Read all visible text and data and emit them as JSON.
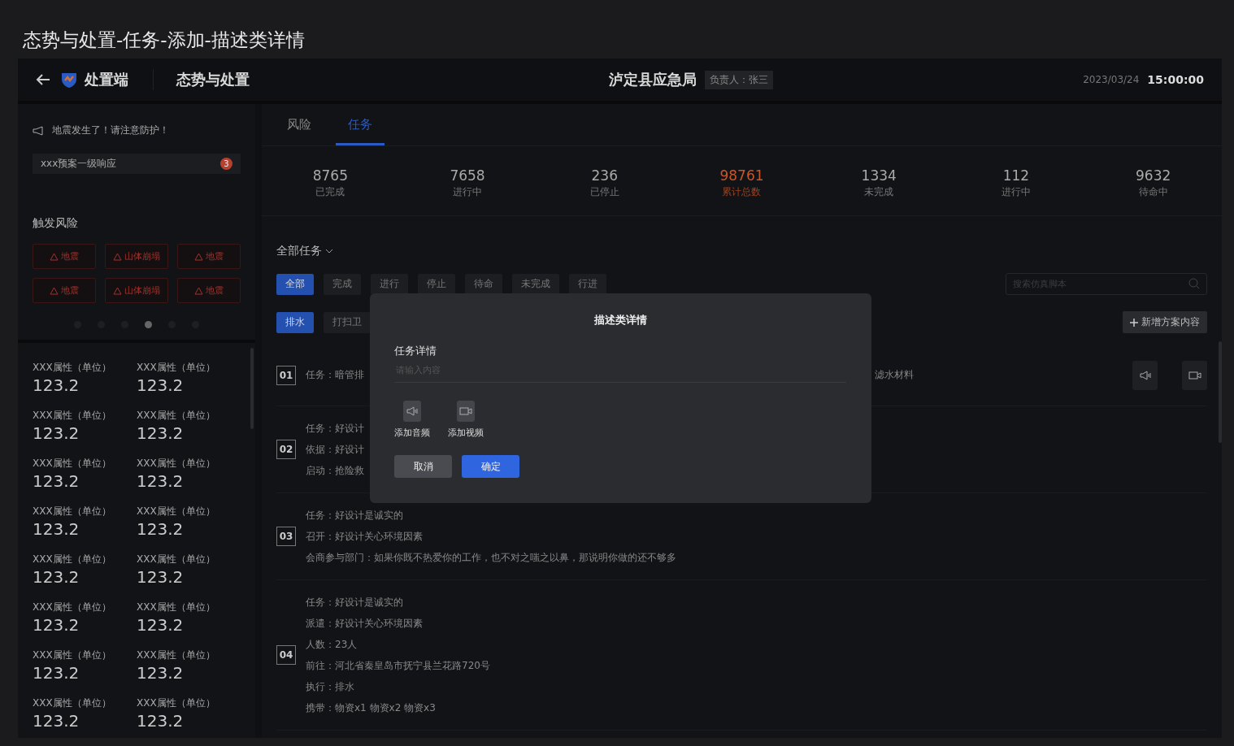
{
  "page_title": "态势与处置-任务-添加-描述类详情",
  "header": {
    "app_name": "处置端",
    "module": "态势与处置",
    "org": "泸定县应急局",
    "owner": "负责人：张三",
    "date": "2023/03/24",
    "time": "15:00:00"
  },
  "sidebar": {
    "notice": "地震发生了！请注意防护！",
    "plan": {
      "label": "xxx预案一级响应",
      "badge": "3"
    },
    "risk_title": "触发风险",
    "risks": [
      {
        "label": "地震"
      },
      {
        "label": "山体崩塌"
      },
      {
        "label": "地震"
      },
      {
        "label": "地震"
      },
      {
        "label": "山体崩塌"
      },
      {
        "label": "地震"
      }
    ],
    "pages": [
      {
        "selected": false
      },
      {
        "selected": false
      },
      {
        "selected": false
      },
      {
        "selected": true
      },
      {
        "selected": false
      },
      {
        "selected": false
      }
    ],
    "properties": [
      {
        "label": "XXX属性（单位）",
        "value": "123.2"
      },
      {
        "label": "XXX属性（单位）",
        "value": "123.2"
      },
      {
        "label": "XXX属性（单位）",
        "value": "123.2"
      },
      {
        "label": "XXX属性（单位）",
        "value": "123.2"
      },
      {
        "label": "XXX属性（单位）",
        "value": "123.2"
      },
      {
        "label": "XXX属性（单位）",
        "value": "123.2"
      },
      {
        "label": "XXX属性（单位）",
        "value": "123.2"
      },
      {
        "label": "XXX属性（单位）",
        "value": "123.2"
      },
      {
        "label": "XXX属性（单位）",
        "value": "123.2"
      },
      {
        "label": "XXX属性（单位）",
        "value": "123.2"
      },
      {
        "label": "XXX属性（单位）",
        "value": "123.2"
      },
      {
        "label": "XXX属性（单位）",
        "value": "123.2"
      },
      {
        "label": "XXX属性（单位）",
        "value": "123.2"
      },
      {
        "label": "XXX属性（单位）",
        "value": "123.2"
      },
      {
        "label": "XXX属性（单位）",
        "value": "123.2"
      },
      {
        "label": "XXX属性（单位）",
        "value": "123.2"
      }
    ]
  },
  "tabs": [
    {
      "label": "风险",
      "selected": false
    },
    {
      "label": "任务",
      "selected": true
    }
  ],
  "stats": [
    {
      "value": "8765",
      "label": "已完成",
      "highlight": false
    },
    {
      "value": "7658",
      "label": "进行中",
      "highlight": false
    },
    {
      "value": "236",
      "label": "已停止",
      "highlight": false
    },
    {
      "value": "98761",
      "label": "累计总数",
      "highlight": true
    },
    {
      "value": "1334",
      "label": "未完成",
      "highlight": false
    },
    {
      "value": "112",
      "label": "进行中",
      "highlight": false
    },
    {
      "value": "9632",
      "label": "待命中",
      "highlight": false
    }
  ],
  "filter": {
    "label": "全部任务"
  },
  "status_chips": [
    {
      "label": "全部",
      "selected": true
    },
    {
      "label": "完成",
      "selected": false
    },
    {
      "label": "进行",
      "selected": false
    },
    {
      "label": "停止",
      "selected": false
    },
    {
      "label": "待命",
      "selected": false
    },
    {
      "label": "未完成",
      "selected": false
    },
    {
      "label": "行进",
      "selected": false
    }
  ],
  "type_chips": [
    {
      "label": "排水",
      "selected": true
    },
    {
      "label": "打扫卫",
      "selected": false
    }
  ],
  "search": {
    "placeholder": "搜索仿真脚本"
  },
  "add_button": "新增方案内容",
  "tasks": [
    {
      "number": "01",
      "media_buttons": true,
      "lines": [
        {
          "label": "任务：",
          "value": "暗管排",
          "trailing": "滤水材料"
        }
      ]
    },
    {
      "number": "02",
      "lines": [
        {
          "label": "任务：",
          "value": "好设计"
        },
        {
          "label": "依据：",
          "value": "好设计"
        },
        {
          "label": "启动：",
          "value": "抢险救"
        }
      ]
    },
    {
      "number": "03",
      "lines": [
        {
          "label": "任务：",
          "value": "好设计是诚实的"
        },
        {
          "label": "召开：",
          "value": "好设计关心环境因素"
        },
        {
          "label": "会商参与部门：",
          "value": "如果你既不热爱你的工作，也不对之嗤之以鼻，那说明你做的还不够多"
        }
      ]
    },
    {
      "number": "04",
      "lines": [
        {
          "label": "任务：",
          "value": "好设计是诚实的"
        },
        {
          "label": "派遣：",
          "value": "好设计关心环境因素"
        },
        {
          "label": "人数：",
          "value": "23人"
        },
        {
          "label": "前往：",
          "value": "河北省秦皇岛市抚宁县兰花路720号"
        },
        {
          "label": "执行：",
          "value": "排水"
        },
        {
          "label": "携带：",
          "value": "物资x1  物资x2  物资x3"
        }
      ]
    }
  ],
  "dialog": {
    "title": "描述类详情",
    "field_label": "任务详情",
    "placeholder": "请输入内容",
    "attachments": [
      {
        "kind": "audio",
        "label": "添加音频"
      },
      {
        "kind": "video",
        "label": "添加视频"
      }
    ],
    "buttons": [
      {
        "label": "取消",
        "primary": false
      },
      {
        "label": "确定",
        "primary": true
      }
    ]
  }
}
